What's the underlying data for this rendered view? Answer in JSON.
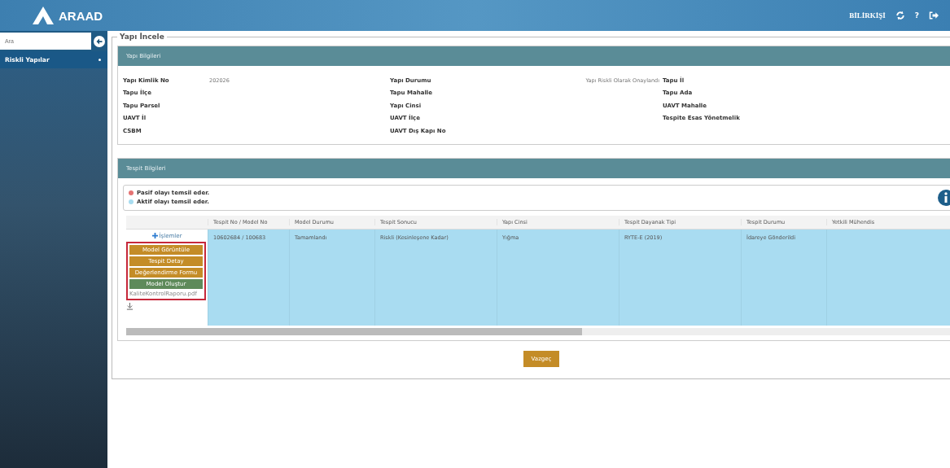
{
  "header": {
    "logo": "ARAAD",
    "user": "BİLİRKİŞİ",
    "help": "?"
  },
  "sidebar": {
    "search": {
      "placeholder": "Ara"
    },
    "items": [
      {
        "label": "Riskli Yapılar",
        "selected": true
      }
    ]
  },
  "page": {
    "title": "Yapı İncele"
  },
  "building_panel": {
    "title": "Yapı Bilgileri",
    "rows": [
      [
        {
          "label": "Yapı Kimlik No",
          "value": "202026"
        },
        {
          "label": "Yapı Durumu",
          "value": "Yapı Riskli Olarak Onaylandı"
        },
        {
          "label": "Tapu İl"
        }
      ],
      [
        {
          "label": "Tapu İlçe"
        },
        {
          "label": "Tapu Mahalle"
        },
        {
          "label": "Tapu Ada"
        }
      ],
      [
        {
          "label": "Tapu Parsel"
        },
        {
          "label": "Yapı Cinsi"
        },
        {
          "label": "UAVT Mahalle"
        }
      ],
      [
        {
          "label": "UAVT İl"
        },
        {
          "label": "UAVT İlçe"
        },
        {
          "label": "Tespite Esas Yönetmelik"
        }
      ],
      [
        {
          "label": "CSBM"
        },
        {
          "label": "UAVT Dış Kapı No"
        }
      ]
    ]
  },
  "detection_panel": {
    "title": "Tespit Bilgileri",
    "legend": [
      {
        "text": "Pasif olayı temsil eder.",
        "color": "#e57373"
      },
      {
        "text": "Aktif olayı temsil eder.",
        "color": "#a8dcf0"
      }
    ],
    "table": {
      "columns": [
        "Tespit No / Model No",
        "Model Durumu",
        "Tespit Sonucu",
        "Yapı Cinsi",
        "Tespit Dayanak Tipi",
        "Tespit Durumu",
        "Yetkili Mühendis"
      ],
      "rows": [
        {
          "selected": true,
          "actions_label": "İşlemler",
          "actions": [
            {
              "label": "Model Görüntüle",
              "kind": "warning"
            },
            {
              "label": "Tespit Detay",
              "kind": "warning"
            },
            {
              "label": "Değerlendirme Formu",
              "kind": "warning"
            },
            {
              "label": "Model Oluştur",
              "kind": "success"
            }
          ],
          "file": "KaliteKontrolRaporu.pdf",
          "cells": [
            "10602684 / 100683",
            "Tamamlandı",
            "Riskli (Kesinleşene Kadar)",
            "Yığma",
            "RYTE-E (2019)",
            "İdareye Gönderildi",
            ""
          ]
        }
      ]
    }
  },
  "buttons": [
    {
      "label": "Vazgeç"
    }
  ]
}
